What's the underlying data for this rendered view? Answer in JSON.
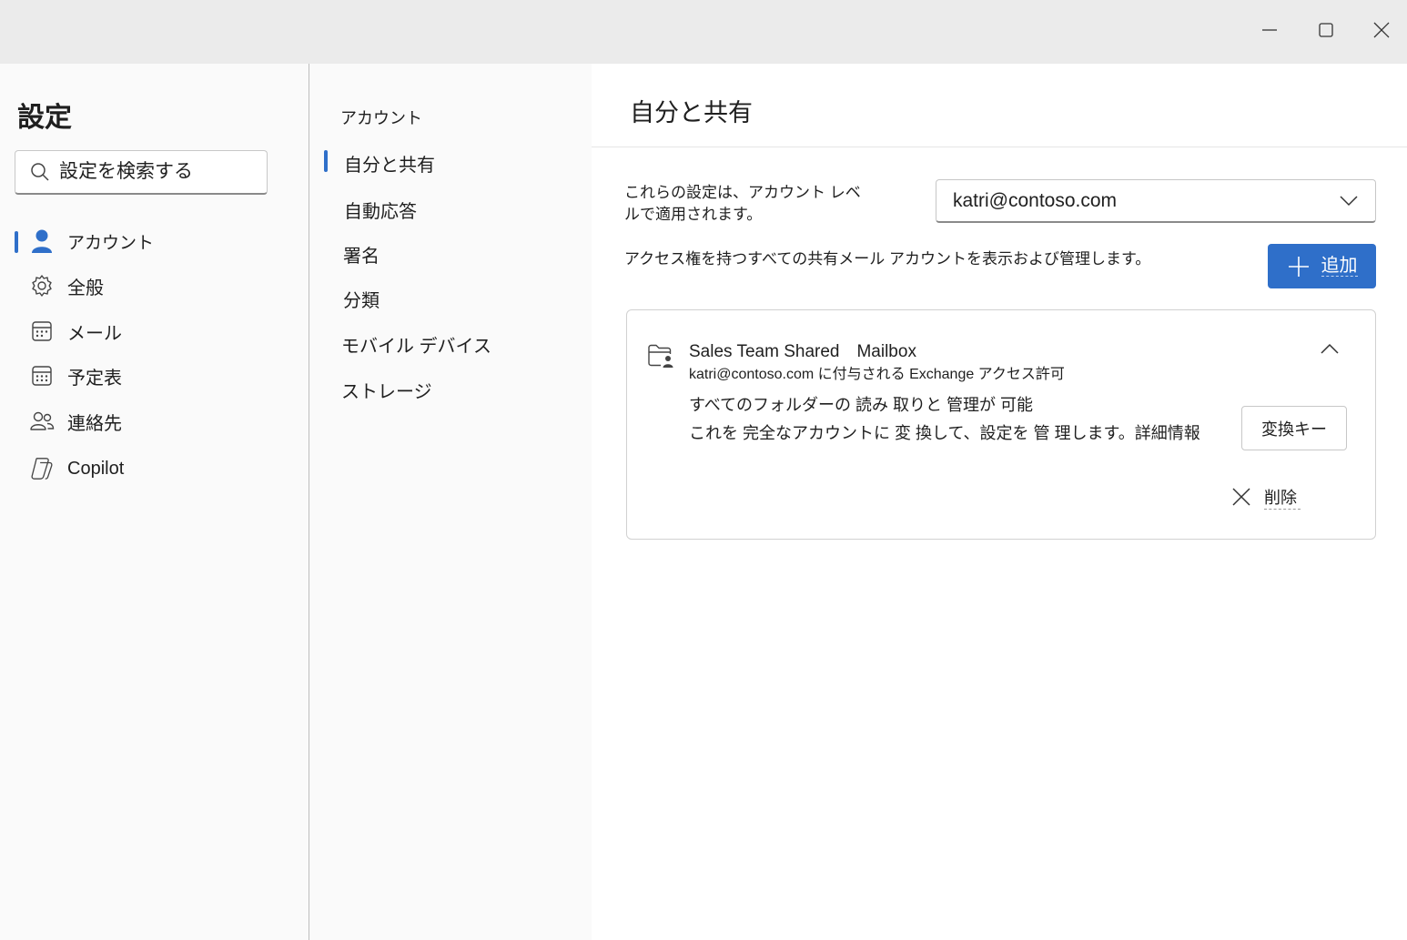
{
  "window": {
    "controls": {
      "minimize": "minimize-icon",
      "maximize": "maximize-icon",
      "close": "close-icon"
    }
  },
  "leftnav": {
    "title": "設定",
    "search_placeholder": "設定を検索する",
    "items": [
      {
        "label": "アカウント",
        "icon": "person-icon",
        "selected": true
      },
      {
        "label": "全般",
        "icon": "gear-icon",
        "selected": false
      },
      {
        "label": "メール",
        "icon": "mail-icon",
        "selected": false
      },
      {
        "label": "予定表",
        "icon": "calendar-icon",
        "selected": false
      },
      {
        "label": "連絡先",
        "icon": "people-icon",
        "selected": false
      },
      {
        "label": "Copilot",
        "icon": "copilot-icon",
        "selected": false
      }
    ]
  },
  "subnav": {
    "header": "アカウント",
    "items": [
      {
        "label": "自分と共有",
        "selected": true
      },
      {
        "label": "自動応答",
        "selected": false
      },
      {
        "label": "署名",
        "selected": false
      },
      {
        "label": "分類",
        "selected": false
      },
      {
        "label": "モバイル デバイス",
        "selected": false
      },
      {
        "label": "ストレージ",
        "selected": false
      }
    ]
  },
  "content": {
    "title": "自分と共有",
    "scope_text": "これらの設定は、アカウント レベルで適用されます。",
    "account_select_value": "katri@contoso.com",
    "description": "アクセス権を持つすべての共有メール アカウントを表示および管理します。",
    "add_button_label": "追加",
    "card": {
      "title": "Sales Team Shared　Mailbox",
      "subtitle": "katri@contoso.com に付与される Exchange アクセス許可",
      "permission_line1": "すべてのフォルダーの 読み 取りと 管理が 可能",
      "permission_line2": "これを 完全なアカウントに 変 換して、設定を 管 理します。",
      "learn_more": "詳細情報",
      "convert_button_label": "変換キー",
      "remove_button_label": "削除"
    }
  },
  "colors": {
    "accent": "#2f6fc9",
    "background": "#fafafa",
    "titlebar": "#ebebeb"
  }
}
